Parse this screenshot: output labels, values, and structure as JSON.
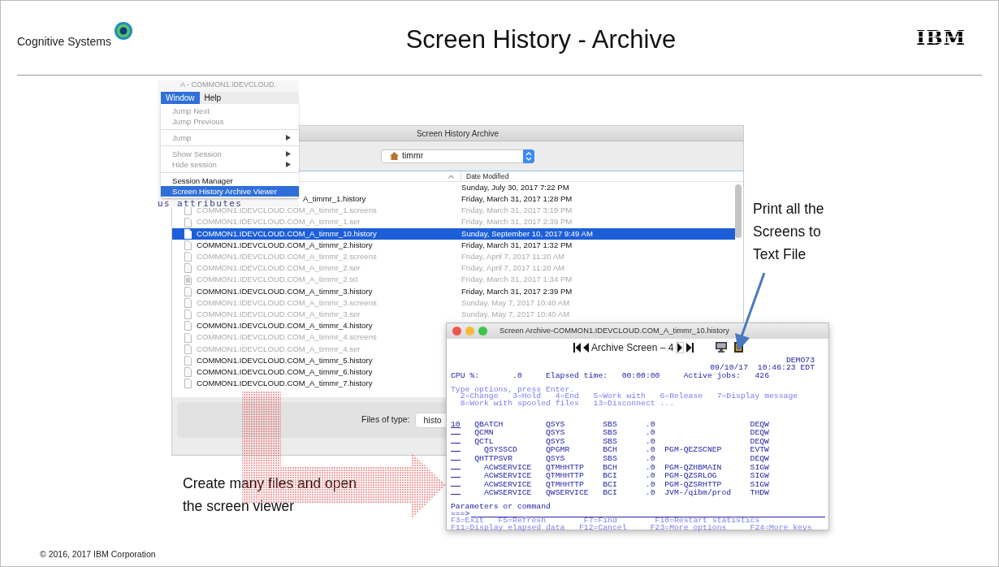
{
  "slide": {
    "brand": "Cognitive Systems",
    "title": "Screen History - Archive",
    "company_logo": "IBM",
    "footer": "© 2016, 2017 IBM Corporation"
  },
  "background_window": {
    "title": "A - COMMON1.IDEVCLOUD.",
    "text": "us attributes"
  },
  "menu_bar": {
    "items": [
      {
        "label": "Window",
        "selected": true
      },
      {
        "label": "Help",
        "selected": false
      }
    ]
  },
  "menu": {
    "items": [
      {
        "kind": "item",
        "label": "Jump Next",
        "disabled": true,
        "submenu": false,
        "selected": false
      },
      {
        "kind": "item",
        "label": "Jump Previous",
        "disabled": true,
        "submenu": false,
        "selected": false
      },
      {
        "kind": "separator"
      },
      {
        "kind": "item",
        "label": "Jump",
        "disabled": true,
        "submenu": true,
        "selected": false
      },
      {
        "kind": "separator"
      },
      {
        "kind": "item",
        "label": "Show Session",
        "disabled": true,
        "submenu": true,
        "selected": false
      },
      {
        "kind": "item",
        "label": "Hide session",
        "disabled": true,
        "submenu": true,
        "selected": false
      },
      {
        "kind": "separator"
      },
      {
        "kind": "item",
        "label": "Session Manager",
        "disabled": false,
        "submenu": false,
        "selected": false
      },
      {
        "kind": "item",
        "label": "Screen History Archive Viewer",
        "disabled": false,
        "submenu": false,
        "selected": true
      }
    ]
  },
  "file_dialog": {
    "title": "Screen History Archive",
    "folder": "timmr",
    "column": "Date Modified",
    "files": [
      {
        "kind": "file",
        "date": "Sunday, July 30, 2017 7:22 PM",
        "disabled": false,
        "selected": false
      },
      {
        "kind": "file",
        "name_fragment": "A_timmr_1.history",
        "date": "Friday, March 31, 2017 1:28 PM",
        "disabled": false,
        "selected": false
      },
      {
        "kind": "file",
        "name": "COMMON1.IDEVCLOUD.COM_A_timmr_1.screens",
        "date": "Friday, March 31, 2017 3:19 PM",
        "disabled": true,
        "selected": false
      },
      {
        "kind": "file",
        "name": "COMMON1.IDEVCLOUD.COM_A_timmr_1.ser",
        "date": "Friday, March 31, 2017 2:39 PM",
        "disabled": true,
        "selected": false
      },
      {
        "kind": "file",
        "name": "COMMON1.IDEVCLOUD.COM_A_timmr_10.history",
        "date": "Sunday, September 10, 2017 9:49 AM",
        "disabled": false,
        "selected": true
      },
      {
        "kind": "file",
        "name": "COMMON1.IDEVCLOUD.COM_A_timmr_2.history",
        "date": "Friday, March 31, 2017 1:32 PM",
        "disabled": false,
        "selected": false
      },
      {
        "kind": "file",
        "name": "COMMON1.IDEVCLOUD.COM_A_timmr_2.screens",
        "date": "Friday, April 7, 2017 11:20 AM",
        "disabled": true,
        "selected": false
      },
      {
        "kind": "file",
        "name": "COMMON1.IDEVCLOUD.COM_A_timmr_2.ser",
        "date": "Friday, April 7, 2017 11:20 AM",
        "disabled": true,
        "selected": false
      },
      {
        "kind": "text",
        "name": "COMMON1.IDEVCLOUD.COM_A_timmr_2.txt",
        "date": "Friday, March 31, 2017 1:34 PM",
        "disabled": true,
        "selected": false
      },
      {
        "kind": "file",
        "name": "COMMON1.IDEVCLOUD.COM_A_timmr_3.history",
        "date": "Friday, March 31, 2017 2:39 PM",
        "disabled": false,
        "selected": false
      },
      {
        "kind": "file",
        "name": "COMMON1.IDEVCLOUD.COM_A_timmr_3.screens",
        "date": "Sunday, May 7, 2017 10:40 AM",
        "disabled": true,
        "selected": false
      },
      {
        "kind": "file",
        "name": "COMMON1.IDEVCLOUD.COM_A_timmr_3.ser",
        "date": "Sunday, May 7, 2017 10:40 AM",
        "disabled": true,
        "selected": false
      },
      {
        "kind": "file",
        "name": "COMMON1.IDEVCLOUD.COM_A_timmr_4.history",
        "disabled": false,
        "selected": false
      },
      {
        "kind": "file",
        "name": "COMMON1.IDEVCLOUD.COM_A_timmr_4.screens",
        "disabled": true,
        "selected": false
      },
      {
        "kind": "file",
        "name": "COMMON1.IDEVCLOUD.COM_A_timmr_4.ser",
        "disabled": true,
        "selected": false
      },
      {
        "kind": "file",
        "name": "COMMON1.IDEVCLOUD.COM_A_timmr_5.history",
        "disabled": false,
        "selected": false
      },
      {
        "kind": "file",
        "name": "COMMON1.IDEVCLOUD.COM_A_timmr_6.history",
        "disabled": false,
        "selected": false
      },
      {
        "kind": "file",
        "name": "COMMON1.IDEVCLOUD.COM_A_timmr_7.history",
        "disabled": false,
        "selected": false
      }
    ],
    "filter_label": "Files of type:",
    "filter_value": "histo"
  },
  "archive_viewer": {
    "title": "Screen Archive-COMMON1.IDEVCLOUD.COM_A_timmr_10.history",
    "screen_label": "Archive Screen – 4",
    "header_lines": [
      {
        "kind": "system",
        "text": "DEMO73"
      },
      {
        "kind": "datetime",
        "text": "09/10/17  10:46:23 EDT"
      },
      {
        "kind": "stats",
        "text": "CPU %:       .0     Elapsed time:   00:00:00     Active jobs:   426"
      },
      {
        "kind": "instruction",
        "text": "Type options, press Enter."
      },
      {
        "kind": "options",
        "text": "  2=Change   3=Hold   4=End   5=Work with   6=Release   7=Display message"
      },
      {
        "kind": "options",
        "text": "  8=Work with spooled files   13=Disconnect ..."
      }
    ],
    "jobs": [
      {
        "option": "10",
        "job": "QBATCH",
        "user": "QSYS",
        "type": "SBS",
        "cpu": ".0",
        "status": "DEQW"
      },
      {
        "job": "QCMN",
        "user": "QSYS",
        "type": "SBS",
        "cpu": ".0",
        "status": "DEQW"
      },
      {
        "job": "QCTL",
        "user": "QSYS",
        "type": "SBS",
        "cpu": ".0",
        "status": "DEQW",
        "children": [
          {
            "job": "QSYSSCD",
            "user": "QPGMR",
            "type": "BCH",
            "cpu": ".0",
            "function": "PGM-QEZSCNEP",
            "status": "EVTW"
          }
        ]
      },
      {
        "job": "QHTTPSVR",
        "user": "QSYS",
        "type": "SBS",
        "cpu": ".0",
        "status": "DEQW",
        "children": [
          {
            "job": "ACWSERVICE",
            "user": "QTMHHTTP",
            "type": "BCH",
            "cpu": ".0",
            "function": "PGM-QZHBMAIN",
            "status": "SIGW"
          },
          {
            "job": "ACWSERVICE",
            "user": "QTMHHTTP",
            "type": "BCI",
            "cpu": ".0",
            "function": "PGM-QZSRLOG",
            "status": "SIGW"
          },
          {
            "job": "ACWSERVICE",
            "user": "QTMHHTTP",
            "type": "BCI",
            "cpu": ".0",
            "function": "PGM-QZSRHTTP",
            "status": "SIGW"
          },
          {
            "job": "ACWSERVICE",
            "user": "QWSERVICE",
            "type": "BCI",
            "cpu": ".0",
            "function": "JVM-/qibm/prod",
            "status": "THDW"
          }
        ]
      }
    ],
    "command_label": "Parameters or command",
    "prompt": "===>",
    "key_lines": [
      "F3=Exit   F5=Refresh        F7=Find        F10=Restart statistics",
      "F11=Display elapsed data   F12=Cancel     F23=More options     F24=More keys"
    ]
  },
  "callouts": [
    {
      "kind": "print",
      "text": "Print all the Screens to Text File"
    },
    {
      "kind": "create",
      "text": "Create many files and open the screen viewer"
    }
  ]
}
